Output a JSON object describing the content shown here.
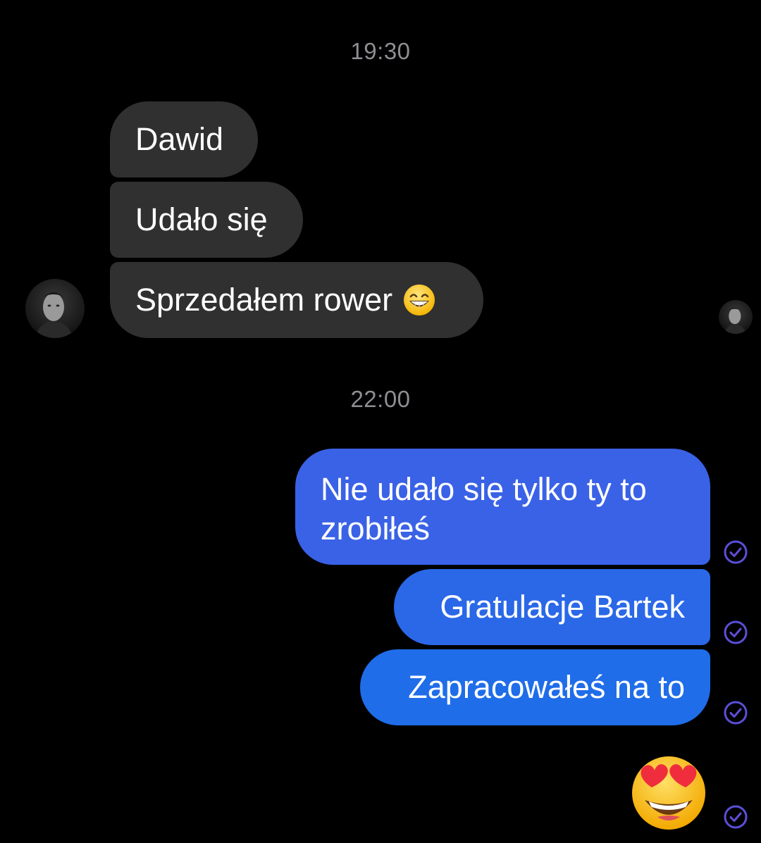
{
  "conversation": {
    "timestamp_1": "19:30",
    "timestamp_2": "22:00",
    "incoming": [
      {
        "text": "Dawid"
      },
      {
        "text": "Udało się"
      },
      {
        "text": "Sprzedałem rower",
        "emoji": "grinning-face-with-smiling-eyes"
      }
    ],
    "outgoing": [
      {
        "text": "Nie udało się tylko ty to zrobiłeś",
        "status": "delivered"
      },
      {
        "text": "Gratulacje Bartek",
        "status": "delivered"
      },
      {
        "text": "Zapracowałeś na to",
        "status": "delivered"
      },
      {
        "emoji": "smiling-face-with-heart-eyes",
        "status": "delivered"
      }
    ]
  },
  "colors": {
    "background": "#000000",
    "incoming_bubble": "#303030",
    "outgoing_gradient_top": "#3a5fe0",
    "outgoing_gradient_bottom": "#1d6ae6",
    "check": "#5b4fd8",
    "timestamp": "#8e8e93"
  }
}
